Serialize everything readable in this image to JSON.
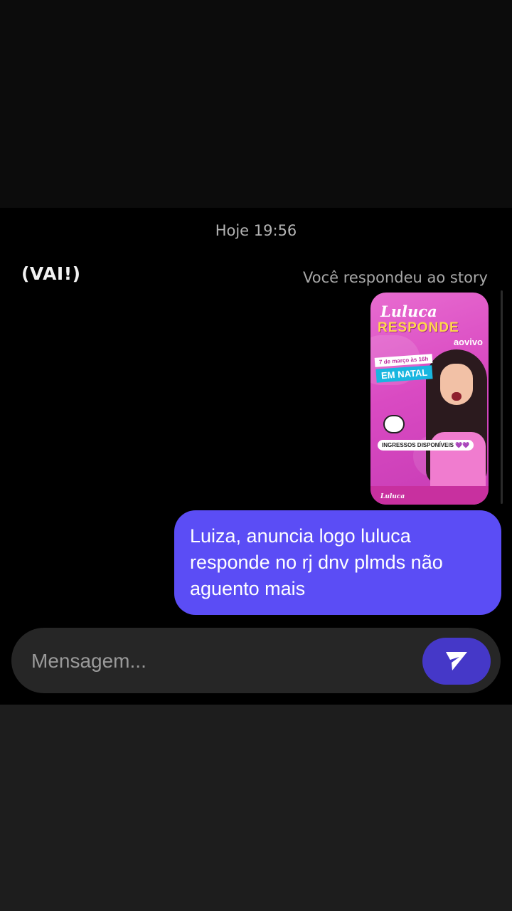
{
  "thread": {
    "timestamp": "Hoje 19:56",
    "overlay_caption": "(VAI!)",
    "story_reply_label": "Você respondeu ao story"
  },
  "story": {
    "brand": "Luluca",
    "title": "RESPONDE",
    "subtitle": "aovivo",
    "date_banner": "7 de março às 16h",
    "city_banner": "EM NATAL",
    "tickets_pill": "INGRESSOS DISPONÍVEIS 💜💜",
    "footer_brand": "Luluca",
    "colors": {
      "background": "#d94ac2",
      "title": "#ffd84a",
      "city": "#19b6e0"
    }
  },
  "message": {
    "text": "Luiza, anuncia logo luluca responde no rj dnv plmds não aguento mais",
    "bubble_color": "#5b4df5"
  },
  "composer": {
    "placeholder": "Mensagem...",
    "send_icon": "send-icon"
  }
}
